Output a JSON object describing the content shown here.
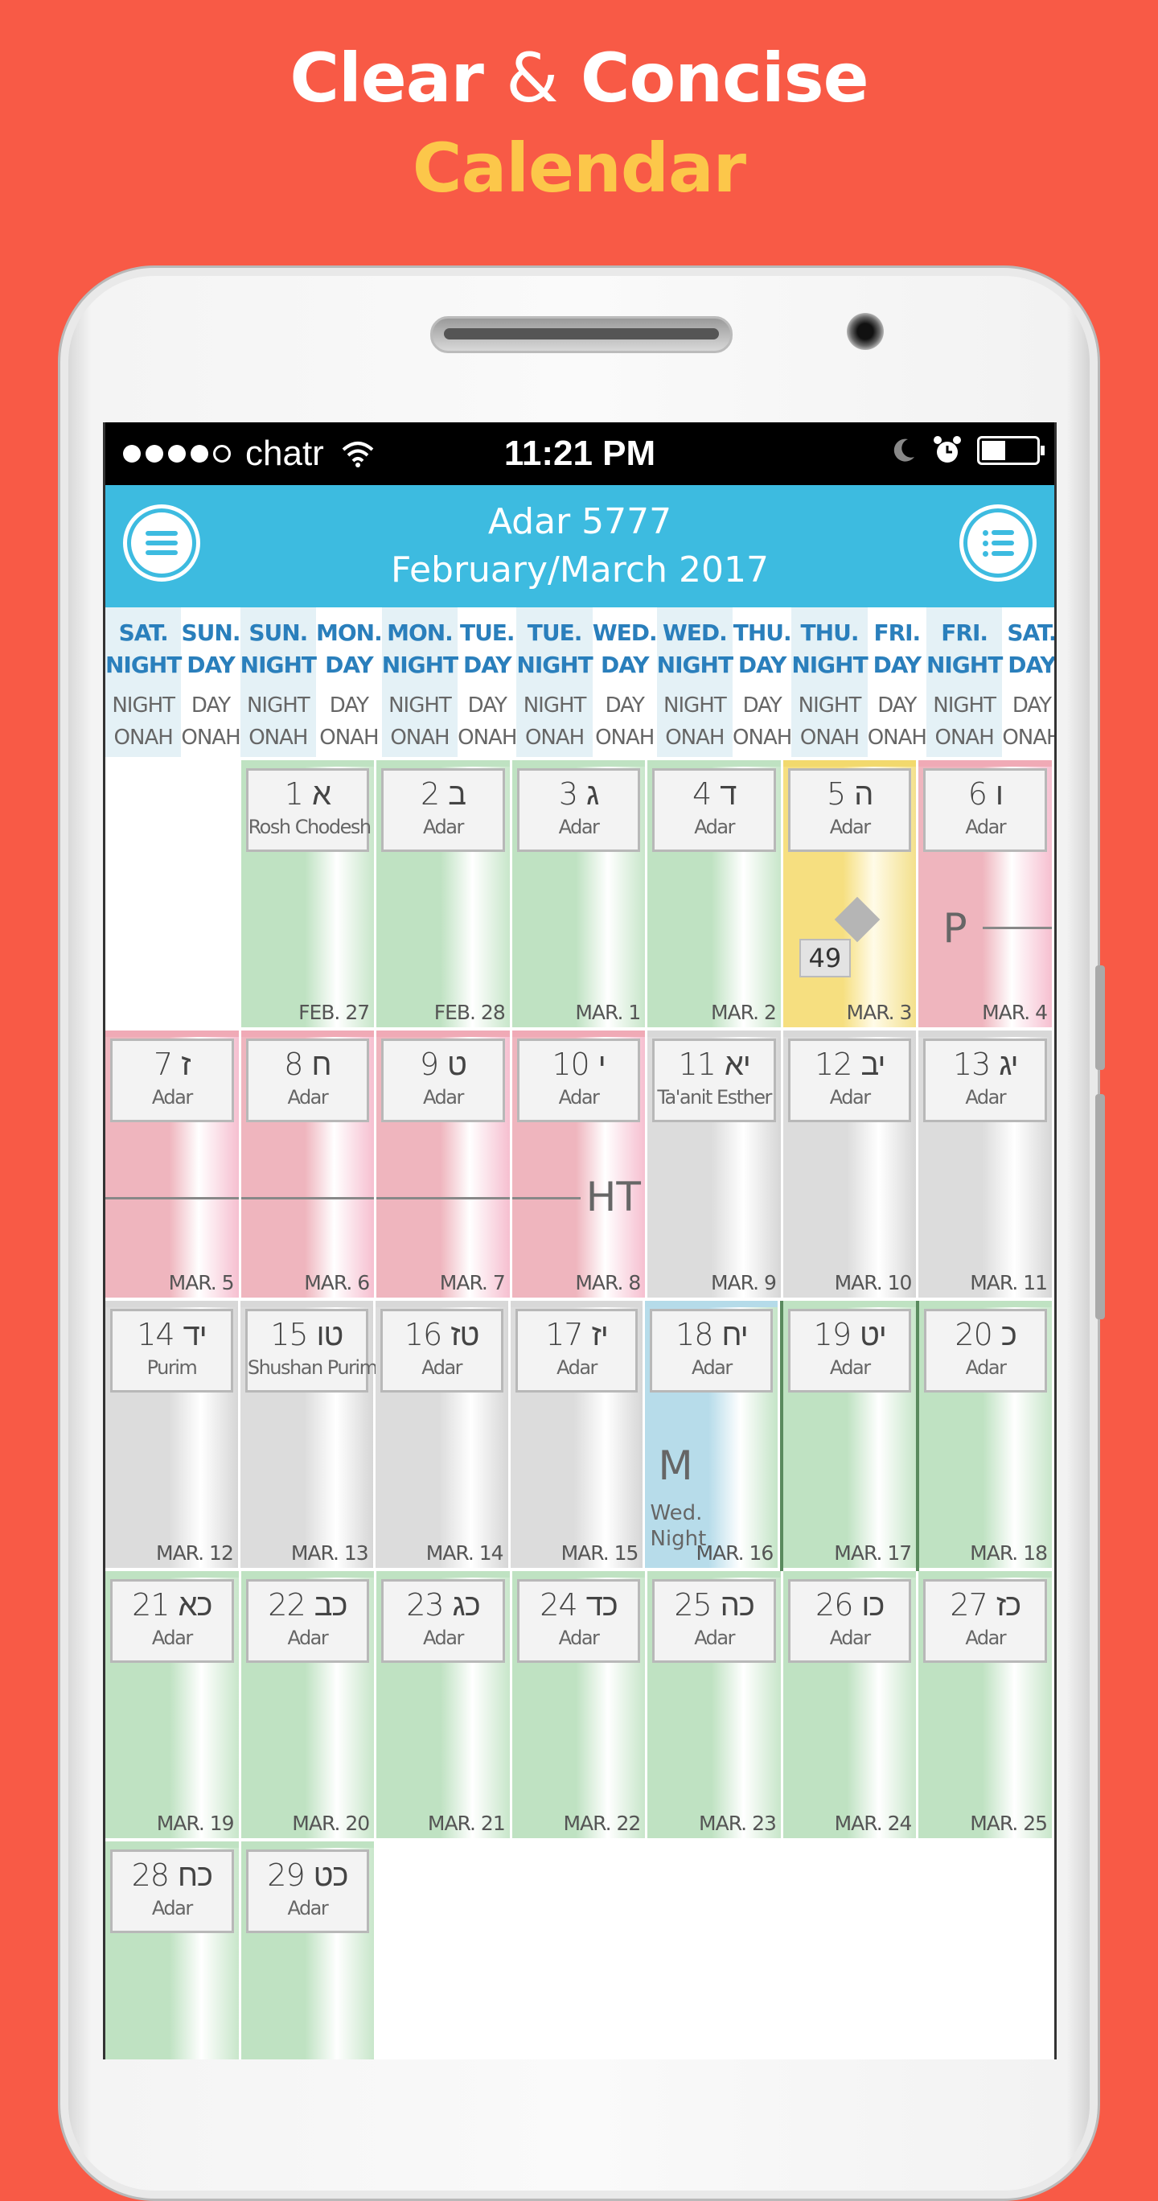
{
  "promo": {
    "line1_a": "Clear",
    "line1_amp": "&",
    "line1_b": "Concise",
    "line2": "Calendar"
  },
  "colors": {
    "background": "#f85a46",
    "promo_accent": "#fcc74a",
    "header": "#3dbbe0",
    "green": "#bfe2c2",
    "pink": "#efb5be",
    "yellow": "#f6df80",
    "gray": "#dcdcdc",
    "blue": "#b7dcea"
  },
  "statusbar": {
    "carrier": "chatr",
    "signal_bars": 4,
    "signal_total": 5,
    "time": "11:21 PM",
    "icons": [
      "wifi-icon",
      "moon-icon",
      "alarm-icon",
      "battery-icon"
    ]
  },
  "header": {
    "title": "Adar 5777",
    "subtitle": "February/March 2017",
    "left_icon": "menu-icon",
    "right_icon": "list-icon"
  },
  "column_heads": [
    {
      "top1": "SAT.",
      "top2": "NIGHT",
      "b1": "NIGHT",
      "b2": "ONAH"
    },
    {
      "top1": "SUN.",
      "top2": "DAY",
      "b1": "DAY",
      "b2": "ONAH"
    },
    {
      "top1": "SUN.",
      "top2": "NIGHT",
      "b1": "NIGHT",
      "b2": "ONAH"
    },
    {
      "top1": "MON.",
      "top2": "DAY",
      "b1": "DAY",
      "b2": "ONAH"
    },
    {
      "top1": "MON.",
      "top2": "NIGHT",
      "b1": "NIGHT",
      "b2": "ONAH"
    },
    {
      "top1": "TUE.",
      "top2": "DAY",
      "b1": "DAY",
      "b2": "ONAH"
    },
    {
      "top1": "TUE.",
      "top2": "NIGHT",
      "b1": "NIGHT",
      "b2": "ONAH"
    },
    {
      "top1": "WED.",
      "top2": "DAY",
      "b1": "DAY",
      "b2": "ONAH"
    },
    {
      "top1": "WED.",
      "top2": "NIGHT",
      "b1": "NIGHT",
      "b2": "ONAH"
    },
    {
      "top1": "THU.",
      "top2": "DAY",
      "b1": "DAY",
      "b2": "ONAH"
    },
    {
      "top1": "THU.",
      "top2": "NIGHT",
      "b1": "NIGHT",
      "b2": "ONAH"
    },
    {
      "top1": "FRI.",
      "top2": "DAY",
      "b1": "DAY",
      "b2": "ONAH"
    },
    {
      "top1": "FRI.",
      "top2": "NIGHT",
      "b1": "NIGHT",
      "b2": "ONAH"
    },
    {
      "top1": "SAT.",
      "top2": "DAY",
      "b1": "DAY",
      "b2": "ONAH"
    }
  ],
  "weeks": [
    [
      {
        "empty": true
      },
      {
        "day": "1 א",
        "label": "Rosh Chodesh",
        "greg": "FEB. 27",
        "color": "green"
      },
      {
        "day": "2 ב",
        "label": "Adar",
        "greg": "FEB. 28",
        "color": "green"
      },
      {
        "day": "3 ג",
        "label": "Adar",
        "greg": "MAR. 1",
        "color": "green"
      },
      {
        "day": "4 ד",
        "label": "Adar",
        "greg": "MAR. 2",
        "color": "green"
      },
      {
        "day": "5 ה",
        "label": "Adar",
        "greg": "MAR. 3",
        "color": "yellow",
        "counter": "49"
      },
      {
        "day": "6 ו",
        "label": "Adar",
        "greg": "MAR. 4",
        "color": "pink",
        "mark": "P"
      }
    ],
    [
      {
        "day": "7 ז",
        "label": "Adar",
        "greg": "MAR. 5",
        "color": "pink"
      },
      {
        "day": "8 ח",
        "label": "Adar",
        "greg": "MAR. 6",
        "color": "pink"
      },
      {
        "day": "9 ט",
        "label": "Adar",
        "greg": "MAR. 7",
        "color": "pink"
      },
      {
        "day": "10 י",
        "label": "Adar",
        "greg": "MAR. 8",
        "color": "pink",
        "mark": "HT"
      },
      {
        "day": "11 יא",
        "label": "Ta'anit Esther",
        "greg": "MAR. 9",
        "color": "gray"
      },
      {
        "day": "12 יב",
        "label": "Adar",
        "greg": "MAR. 10",
        "color": "gray"
      },
      {
        "day": "13 יג",
        "label": "Adar",
        "greg": "MAR. 11",
        "color": "gray"
      }
    ],
    [
      {
        "day": "14 יד",
        "label": "Purim",
        "greg": "MAR. 12",
        "color": "gray"
      },
      {
        "day": "15 טו",
        "label": "Shushan Purim",
        "greg": "MAR. 13",
        "color": "gray"
      },
      {
        "day": "16 טז",
        "label": "Adar",
        "greg": "MAR. 14",
        "color": "gray"
      },
      {
        "day": "17 יז",
        "label": "Adar",
        "greg": "MAR. 15",
        "color": "gray"
      },
      {
        "day": "18 יח",
        "label": "Adar",
        "greg": "MAR. 16",
        "color": "blueg",
        "mark": "M",
        "note": "Wed. Night"
      },
      {
        "day": "19 יט",
        "label": "Adar",
        "greg": "MAR. 17",
        "color": "green"
      },
      {
        "day": "20 כ",
        "label": "Adar",
        "greg": "MAR. 18",
        "color": "green"
      }
    ],
    [
      {
        "day": "21 כא",
        "label": "Adar",
        "greg": "MAR. 19",
        "color": "green"
      },
      {
        "day": "22 כב",
        "label": "Adar",
        "greg": "MAR. 20",
        "color": "green"
      },
      {
        "day": "23 כג",
        "label": "Adar",
        "greg": "MAR. 21",
        "color": "green"
      },
      {
        "day": "24 כד",
        "label": "Adar",
        "greg": "MAR. 22",
        "color": "green"
      },
      {
        "day": "25 כה",
        "label": "Adar",
        "greg": "MAR. 23",
        "color": "green"
      },
      {
        "day": "26 כו",
        "label": "Adar",
        "greg": "MAR. 24",
        "color": "green"
      },
      {
        "day": "27 כז",
        "label": "Adar",
        "greg": "MAR. 25",
        "color": "green"
      }
    ],
    [
      {
        "day": "28 כח",
        "label": "Adar",
        "greg": "",
        "color": "green"
      },
      {
        "day": "29 כט",
        "label": "Adar",
        "greg": "",
        "color": "green"
      },
      {
        "empty": true
      },
      {
        "empty": true
      },
      {
        "empty": true
      },
      {
        "empty": true
      },
      {
        "empty": true
      }
    ]
  ]
}
